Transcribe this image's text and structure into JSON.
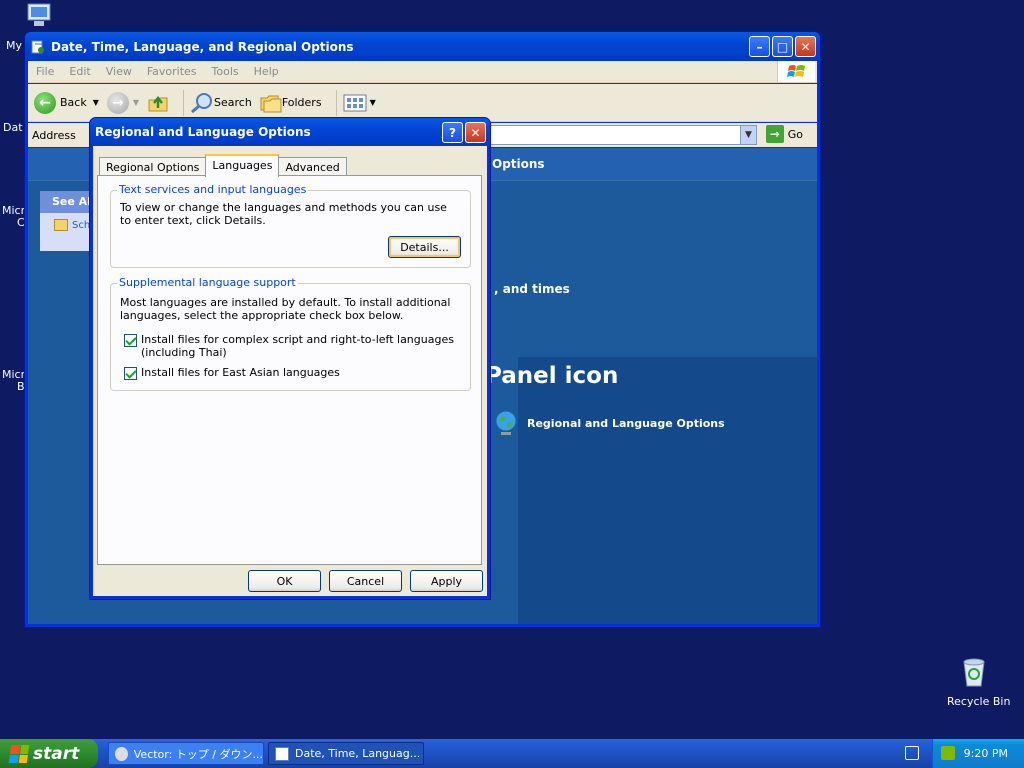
{
  "desktop": {
    "icons": [
      {
        "label": "My"
      },
      {
        "label": "Dat"
      },
      {
        "label": "Micro"
      },
      {
        "label": "C"
      },
      {
        "label": "Micro"
      },
      {
        "label": "B"
      }
    ],
    "recycle_bin": "Recycle Bin"
  },
  "explorer": {
    "title": "Date, Time, Language, and Regional Options",
    "menu": [
      "File",
      "Edit",
      "View",
      "Favorites",
      "Tools",
      "Help"
    ],
    "toolbar": {
      "back": "Back",
      "search": "Search",
      "folders": "Folders"
    },
    "address_label": "Address",
    "go": "Go",
    "header_text": "Options",
    "side_pane_title": "See Al",
    "side_pane_item": "Sch",
    "body_text_1": ", and times",
    "body_text_2": "Panel icon",
    "body_link": "Regional and Language Options"
  },
  "dialog": {
    "title": "Regional and Language Options",
    "tabs": [
      "Regional Options",
      "Languages",
      "Advanced"
    ],
    "active_tab": "Languages",
    "group1": {
      "title": "Text services and input languages",
      "text": "To view or change the languages and methods you can use to enter text, click Details.",
      "button": "Details..."
    },
    "group2": {
      "title": "Supplemental language support",
      "text": "Most languages are installed by default. To install additional languages, select the appropriate check box below.",
      "check1": "Install files for complex script and right-to-left languages (including Thai)",
      "check2": "Install files for East Asian languages"
    },
    "buttons": {
      "ok": "OK",
      "cancel": "Cancel",
      "apply": "Apply"
    }
  },
  "taskbar": {
    "start": "start",
    "items": [
      "Vector: トップ / ダウン...",
      "Date, Time, Languag..."
    ],
    "clock": "9:20 PM"
  }
}
